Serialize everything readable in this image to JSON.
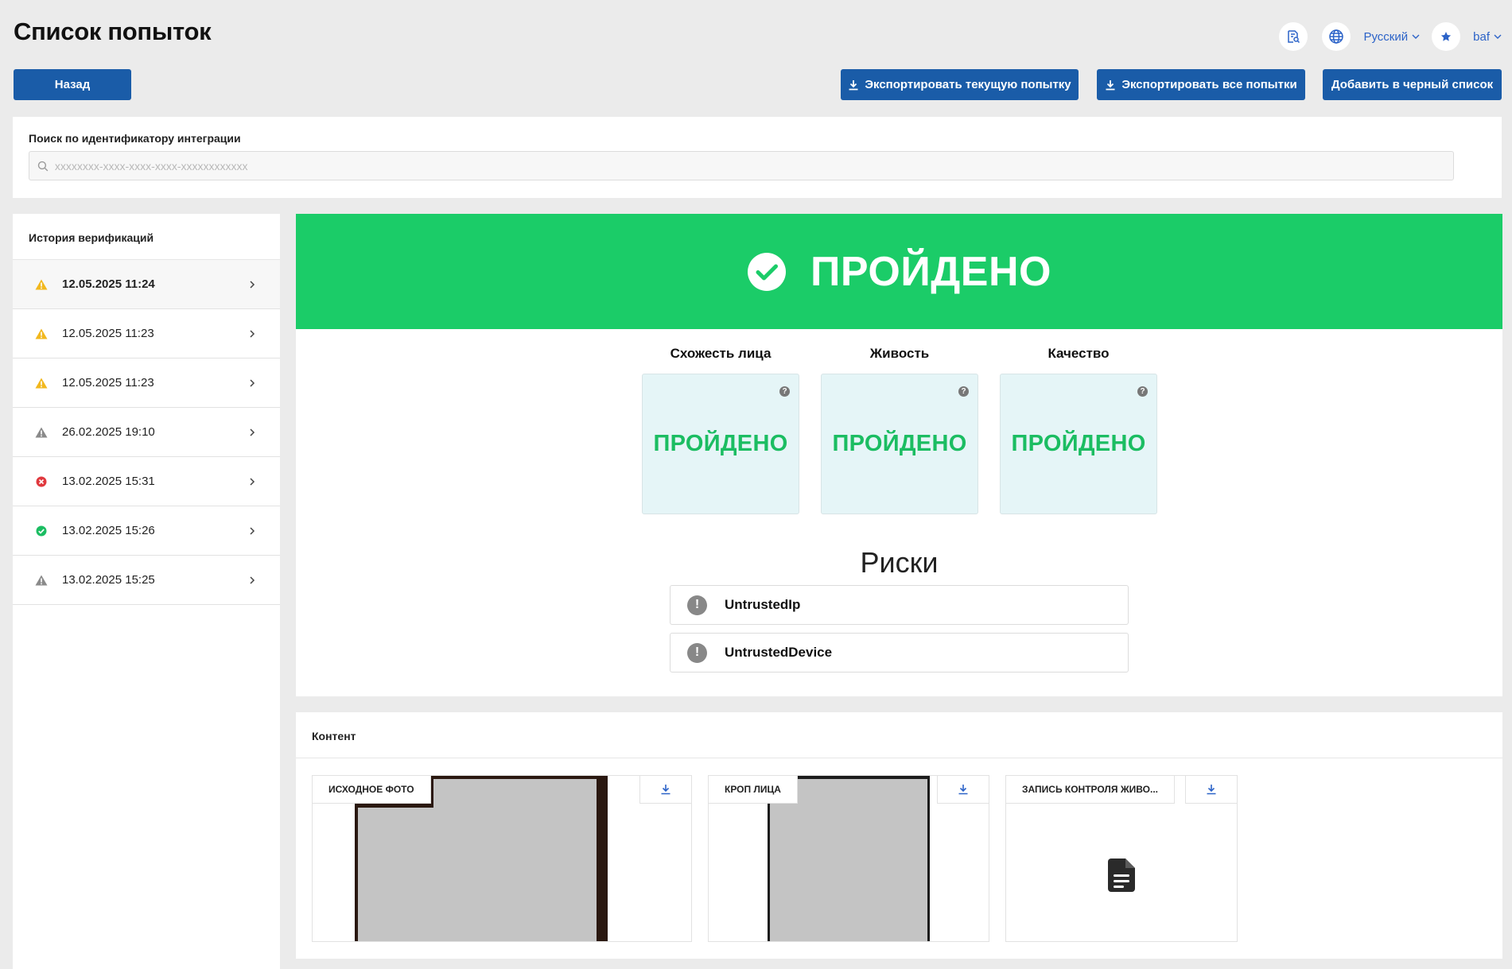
{
  "page": {
    "title": "Список попыток"
  },
  "header": {
    "language": "Русский",
    "user": "baf"
  },
  "toolbar": {
    "back": "Назад",
    "export_current": "Экспортировать текущую попытку",
    "export_all": "Экспортировать все попытки",
    "blacklist": "Добавить в черный список"
  },
  "search": {
    "label": "Поиск по идентификатору интеграции",
    "placeholder": "xxxxxxxx-xxxx-xxxx-xxxx-xxxxxxxxxxxx",
    "value": ""
  },
  "history": {
    "title": "История верификаций",
    "items": [
      {
        "date": "12.05.2025 11:24",
        "status": "warning",
        "color": "#f2b81e"
      },
      {
        "date": "12.05.2025 11:23",
        "status": "warning",
        "color": "#f2b81e"
      },
      {
        "date": "12.05.2025 11:23",
        "status": "warning",
        "color": "#f2b81e"
      },
      {
        "date": "26.02.2025 19:10",
        "status": "neutral",
        "color": "#8a8a8a"
      },
      {
        "date": "13.02.2025 15:31",
        "status": "error",
        "color": "#e0393e"
      },
      {
        "date": "13.02.2025 15:26",
        "status": "success",
        "color": "#1bbd62"
      },
      {
        "date": "13.02.2025 15:25",
        "status": "neutral",
        "color": "#8a8a8a"
      }
    ]
  },
  "result": {
    "status": "ПРОЙДЕНО",
    "status_color": "#1bcc68",
    "checks": [
      {
        "title": "Схожесть лица",
        "value": "ПРОЙДЕНО"
      },
      {
        "title": "Живость",
        "value": "ПРОЙДЕНО"
      },
      {
        "title": "Качество",
        "value": "ПРОЙДЕНО"
      }
    ],
    "risks_title": "Риски",
    "risks": [
      {
        "name": "UntrustedIp"
      },
      {
        "name": "UntrustedDevice"
      }
    ]
  },
  "content": {
    "title": "Контент",
    "items": [
      {
        "label": "ИСХОДНОЕ ФОТО"
      },
      {
        "label": "КРОП ЛИЦА"
      },
      {
        "label": "ЗАПИСЬ КОНТРОЛЯ ЖИВО..."
      }
    ]
  }
}
